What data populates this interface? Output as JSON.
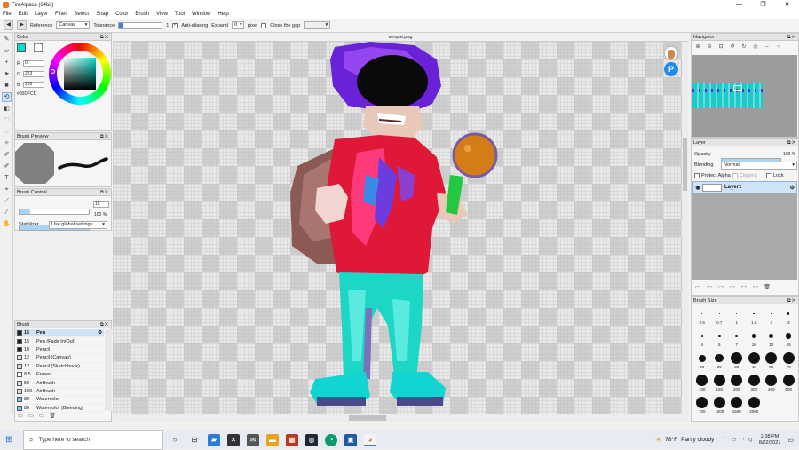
{
  "window": {
    "title": "FireAlpaca (64bit)",
    "min": "—",
    "max": "❐",
    "close": "✕"
  },
  "menu": [
    "File",
    "Edit",
    "Layer",
    "Filter",
    "Select",
    "Snap",
    "Color",
    "Brush",
    "View",
    "Tool",
    "Window",
    "Help"
  ],
  "toolbar": {
    "reference_label": "Reference",
    "reference_value": "Canvas",
    "tolerance_label": "Tolerance",
    "tolerance_value": "1",
    "antialias_label": "Anti-aliasing",
    "antialias_checked": "✓",
    "expand_label": "Expand",
    "expand_value": "0",
    "expand_unit": "pixel",
    "close_gap_label": "Close the gap"
  },
  "document": {
    "tab": "senpai.png"
  },
  "color_panel": {
    "title": "Color",
    "r_label": "R",
    "r": "0",
    "g_label": "G",
    "g": "223",
    "b_label": "B",
    "b": "205",
    "hex": "#00DFCD",
    "current": "#00dfcd"
  },
  "brush_preview": {
    "title": "Brush Preview"
  },
  "brush_control": {
    "title": "Brush Control",
    "size": "15",
    "opacity": "100 %",
    "size_fraction": 0.15,
    "opacity_fraction": 1.0,
    "stabilizer_label": "Stabilizer",
    "stabilizer_value": "Use global settings"
  },
  "brush_list": {
    "title": "Brush",
    "items": [
      {
        "size": "15",
        "name": "Pen"
      },
      {
        "size": "15",
        "name": "Pen (Fade In/Out)"
      },
      {
        "size": "10",
        "name": "Pencil"
      },
      {
        "size": "12",
        "name": "Pencil (Canvas)"
      },
      {
        "size": "12",
        "name": "Pencil (Sketchbook)"
      },
      {
        "size": "8.5",
        "name": "Eraser"
      },
      {
        "size": "50",
        "name": "AirBrush"
      },
      {
        "size": "100",
        "name": "AirBrush"
      },
      {
        "size": "80",
        "name": "Watercolor"
      },
      {
        "size": "80",
        "name": "Watercolor (Bleeding)"
      }
    ]
  },
  "navigator": {
    "title": "Navigator"
  },
  "layer_panel": {
    "title": "Layer",
    "opacity_label": "Opacity",
    "opacity_value": "100 %",
    "blending_label": "Blending",
    "blending_value": "Normal",
    "protect_alpha": "Protect Alpha",
    "clipping": "Clipping",
    "lock": "Lock",
    "layer_name": "Layer1"
  },
  "brush_size": {
    "title": "Brush Size",
    "labels": [
      "0.5",
      "0.7",
      "1",
      "1.5",
      "2",
      "3",
      "4",
      "5",
      "7",
      "10",
      "12",
      "15",
      "20",
      "25",
      "30",
      "40",
      "50",
      "70",
      "100",
      "150",
      "200",
      "300",
      "400",
      "500",
      "700",
      "1000",
      "1500",
      "2000"
    ]
  },
  "taskbar": {
    "search_placeholder": "Type here to search",
    "weather_temp": "78°F",
    "weather_text": "Partly cloudy",
    "time": "2:38 PM",
    "date": "8/22/2021"
  },
  "colors": {
    "accent": "#3f7fcf",
    "swatch": "#00dfcd"
  }
}
